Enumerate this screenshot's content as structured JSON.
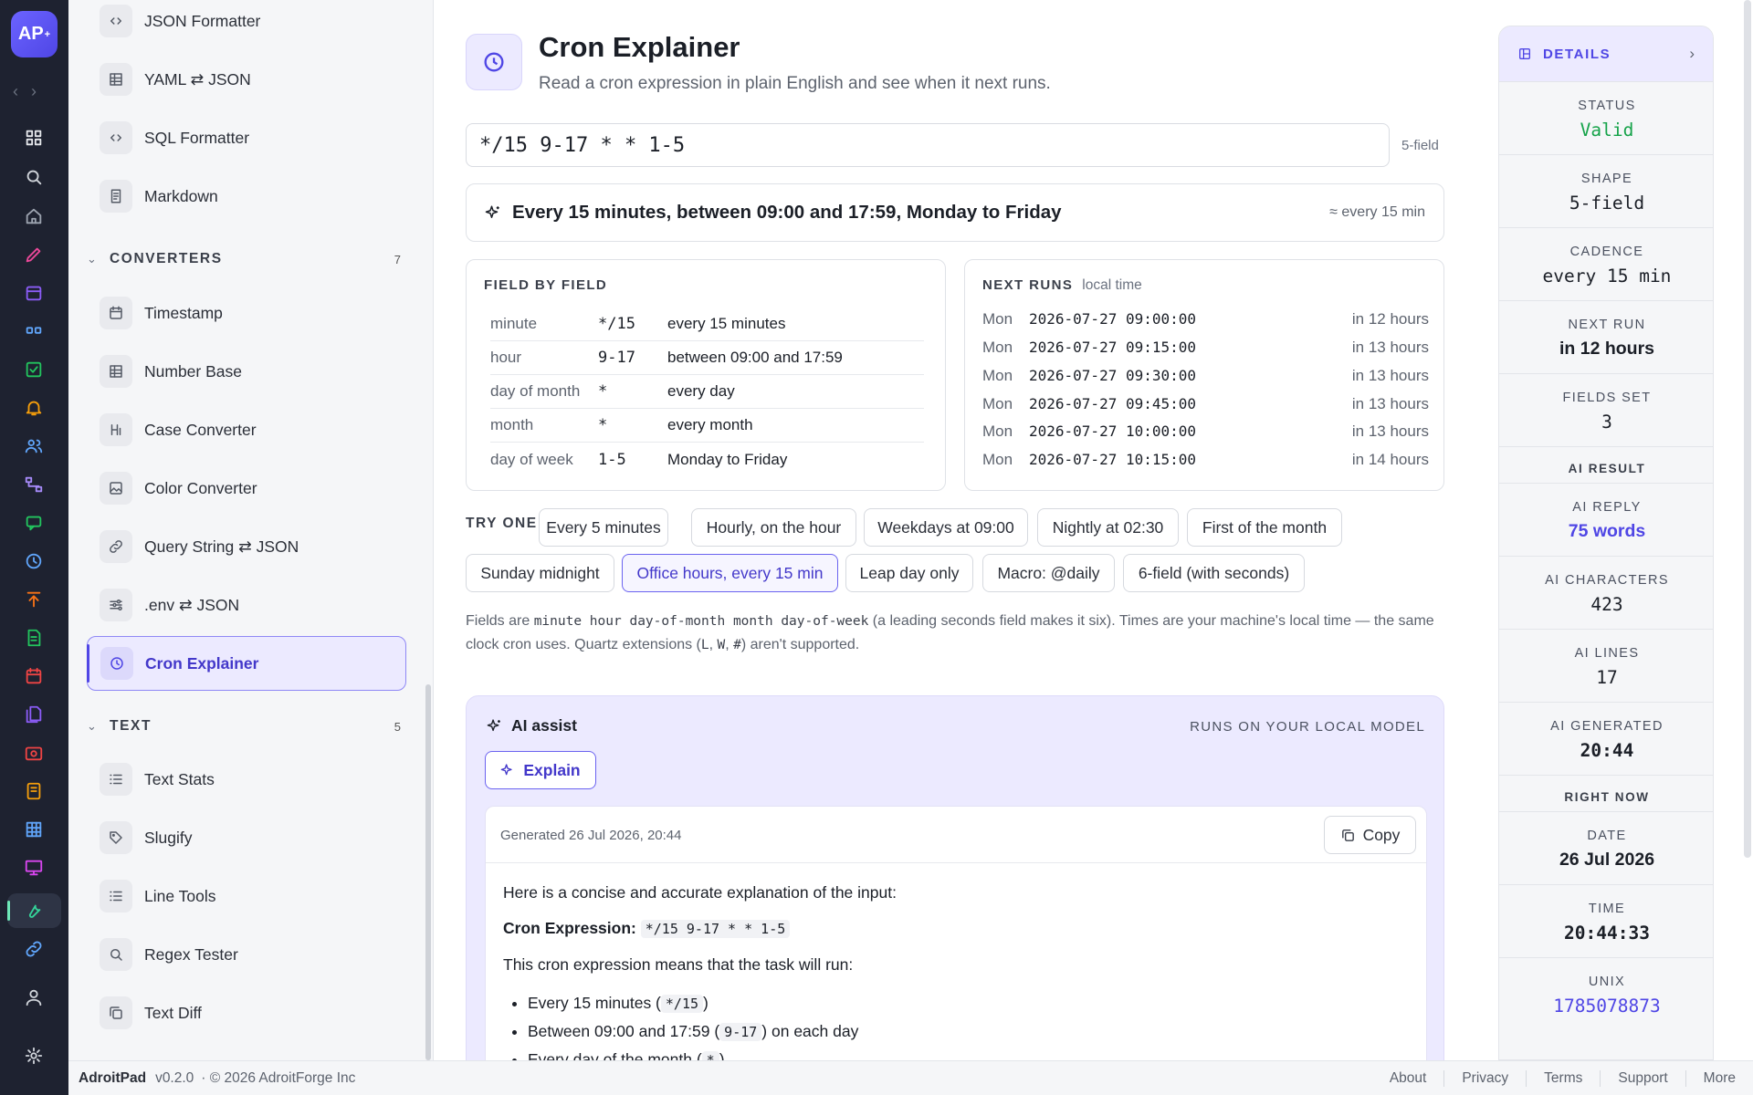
{
  "app": {
    "logo_text": "AP",
    "logo_sup": "+"
  },
  "sidebar": {
    "items_top": [
      {
        "label": "JSON Formatter",
        "icon": "code-icon"
      },
      {
        "label": "YAML ⇄ JSON",
        "icon": "grid-icon"
      },
      {
        "label": "SQL Formatter",
        "icon": "code-icon"
      },
      {
        "label": "Markdown",
        "icon": "document-icon"
      }
    ],
    "converters": {
      "title": "CONVERTERS",
      "count": "7",
      "items": [
        {
          "label": "Timestamp",
          "icon": "calendar-icon"
        },
        {
          "label": "Number Base",
          "icon": "grid-icon"
        },
        {
          "label": "Case Converter",
          "icon": "heading-icon"
        },
        {
          "label": "Color Converter",
          "icon": "image-icon"
        },
        {
          "label": "Query String ⇄ JSON",
          "icon": "link-icon"
        },
        {
          "label": ".env ⇄ JSON",
          "icon": "sliders-icon"
        },
        {
          "label": "Cron Explainer",
          "icon": "clock-icon"
        }
      ]
    },
    "text": {
      "title": "TEXT",
      "count": "5",
      "items": [
        {
          "label": "Text Stats",
          "icon": "list-icon"
        },
        {
          "label": "Slugify",
          "icon": "tag-icon"
        },
        {
          "label": "Line Tools",
          "icon": "list-icon"
        },
        {
          "label": "Regex Tester",
          "icon": "search-icon"
        },
        {
          "label": "Text Diff",
          "icon": "copy-icon"
        }
      ]
    }
  },
  "tool": {
    "title": "Cron Explainer",
    "subtitle": "Read a cron expression in plain English and see when it next runs.",
    "expression": "*/15 9-17 * * 1-5",
    "shape_tag": "5-field",
    "summary": "Every 15 minutes, between 09:00 and 17:59, Monday to Friday",
    "summary_meta": "≈ every 15 min"
  },
  "fields": {
    "title": "FIELD BY FIELD",
    "rows": [
      {
        "name": "minute",
        "value": "*/15",
        "desc": "every 15 minutes"
      },
      {
        "name": "hour",
        "value": "9-17",
        "desc": "between 09:00 and 17:59"
      },
      {
        "name": "day of month",
        "value": "*",
        "desc": "every day"
      },
      {
        "name": "month",
        "value": "*",
        "desc": "every month"
      },
      {
        "name": "day of week",
        "value": "1-5",
        "desc": "Monday to Friday"
      }
    ]
  },
  "runs": {
    "title": "NEXT RUNS",
    "subtitle": "local time",
    "rows": [
      {
        "day": "Mon",
        "ts": "2026-07-27 09:00:00",
        "rel": "in 12 hours"
      },
      {
        "day": "Mon",
        "ts": "2026-07-27 09:15:00",
        "rel": "in 13 hours"
      },
      {
        "day": "Mon",
        "ts": "2026-07-27 09:30:00",
        "rel": "in 13 hours"
      },
      {
        "day": "Mon",
        "ts": "2026-07-27 09:45:00",
        "rel": "in 13 hours"
      },
      {
        "day": "Mon",
        "ts": "2026-07-27 10:00:00",
        "rel": "in 13 hours"
      },
      {
        "day": "Mon",
        "ts": "2026-07-27 10:15:00",
        "rel": "in 14 hours"
      }
    ]
  },
  "try_one": {
    "label": "TRY ONE",
    "chips": [
      "Every 5 minutes",
      "Hourly, on the hour",
      "Weekdays at 09:00",
      "Nightly at 02:30",
      "First of the month",
      "Sunday midnight",
      "Office hours, every 15 min",
      "Leap day only",
      "Macro: @daily",
      "6-field (with seconds)"
    ],
    "selected": "Office hours, every 15 min"
  },
  "note": {
    "prefix": "Fields are ",
    "code": "minute hour day-of-month month day-of-week",
    "mid": " (a leading seconds field makes it six). Times are your machine's local time — the same clock cron uses. Quartz extensions (",
    "q1": "L",
    "sep1": ", ",
    "q2": "W",
    "sep2": ", ",
    "q3": "#",
    "suffix": ") aren't supported."
  },
  "ai": {
    "title": "AI assist",
    "local_label": "RUNS ON YOUR LOCAL MODEL",
    "button": "Explain",
    "generated": "Generated 26 Jul 2026, 20:44",
    "copy": "Copy",
    "intro": "Here is a concise and accurate explanation of the input:",
    "expr_label": "Cron Expression:",
    "expr": "*/15 9-17 * * 1-5",
    "lead": "This cron expression means that the task will run:",
    "bullets": [
      {
        "text": "Every 15 minutes (",
        "code": "*/15",
        "after": ")"
      },
      {
        "text": "Between 09:00 and 17:59 (",
        "code": "9-17",
        "after": ") on each day"
      },
      {
        "text": "Every day of the month (",
        "code": "*",
        "after": ")"
      }
    ]
  },
  "details": {
    "title": "DETAILS",
    "items": [
      {
        "key": "STATUS",
        "value": "Valid"
      },
      {
        "key": "SHAPE",
        "value": "5-field"
      },
      {
        "key": "CADENCE",
        "value": "every 15 min"
      },
      {
        "key": "NEXT RUN",
        "value": "in 12 hours"
      },
      {
        "key": "FIELDS SET",
        "value": "3"
      }
    ],
    "ai_section": "AI RESULT",
    "ai_items": [
      {
        "key": "AI REPLY",
        "value": "75 words"
      },
      {
        "key": "AI CHARACTERS",
        "value": "423"
      },
      {
        "key": "AI LINES",
        "value": "17"
      },
      {
        "key": "AI GENERATED",
        "value": "20:44"
      }
    ],
    "now_section": "RIGHT NOW",
    "now_items": [
      {
        "key": "DATE",
        "value": "26 Jul 2026"
      },
      {
        "key": "TIME",
        "value": "20:44:33"
      },
      {
        "key": "UNIX",
        "value": "1785078873"
      }
    ],
    "colors": {
      "valid": "#16a34a",
      "link": "#4f46e5"
    }
  },
  "footer": {
    "brand": "AdroitPad",
    "version": "v0.2.0",
    "copyright": "· © 2026 AdroitForge Inc",
    "links": [
      "About",
      "Privacy",
      "Terms",
      "Support",
      "More"
    ]
  }
}
